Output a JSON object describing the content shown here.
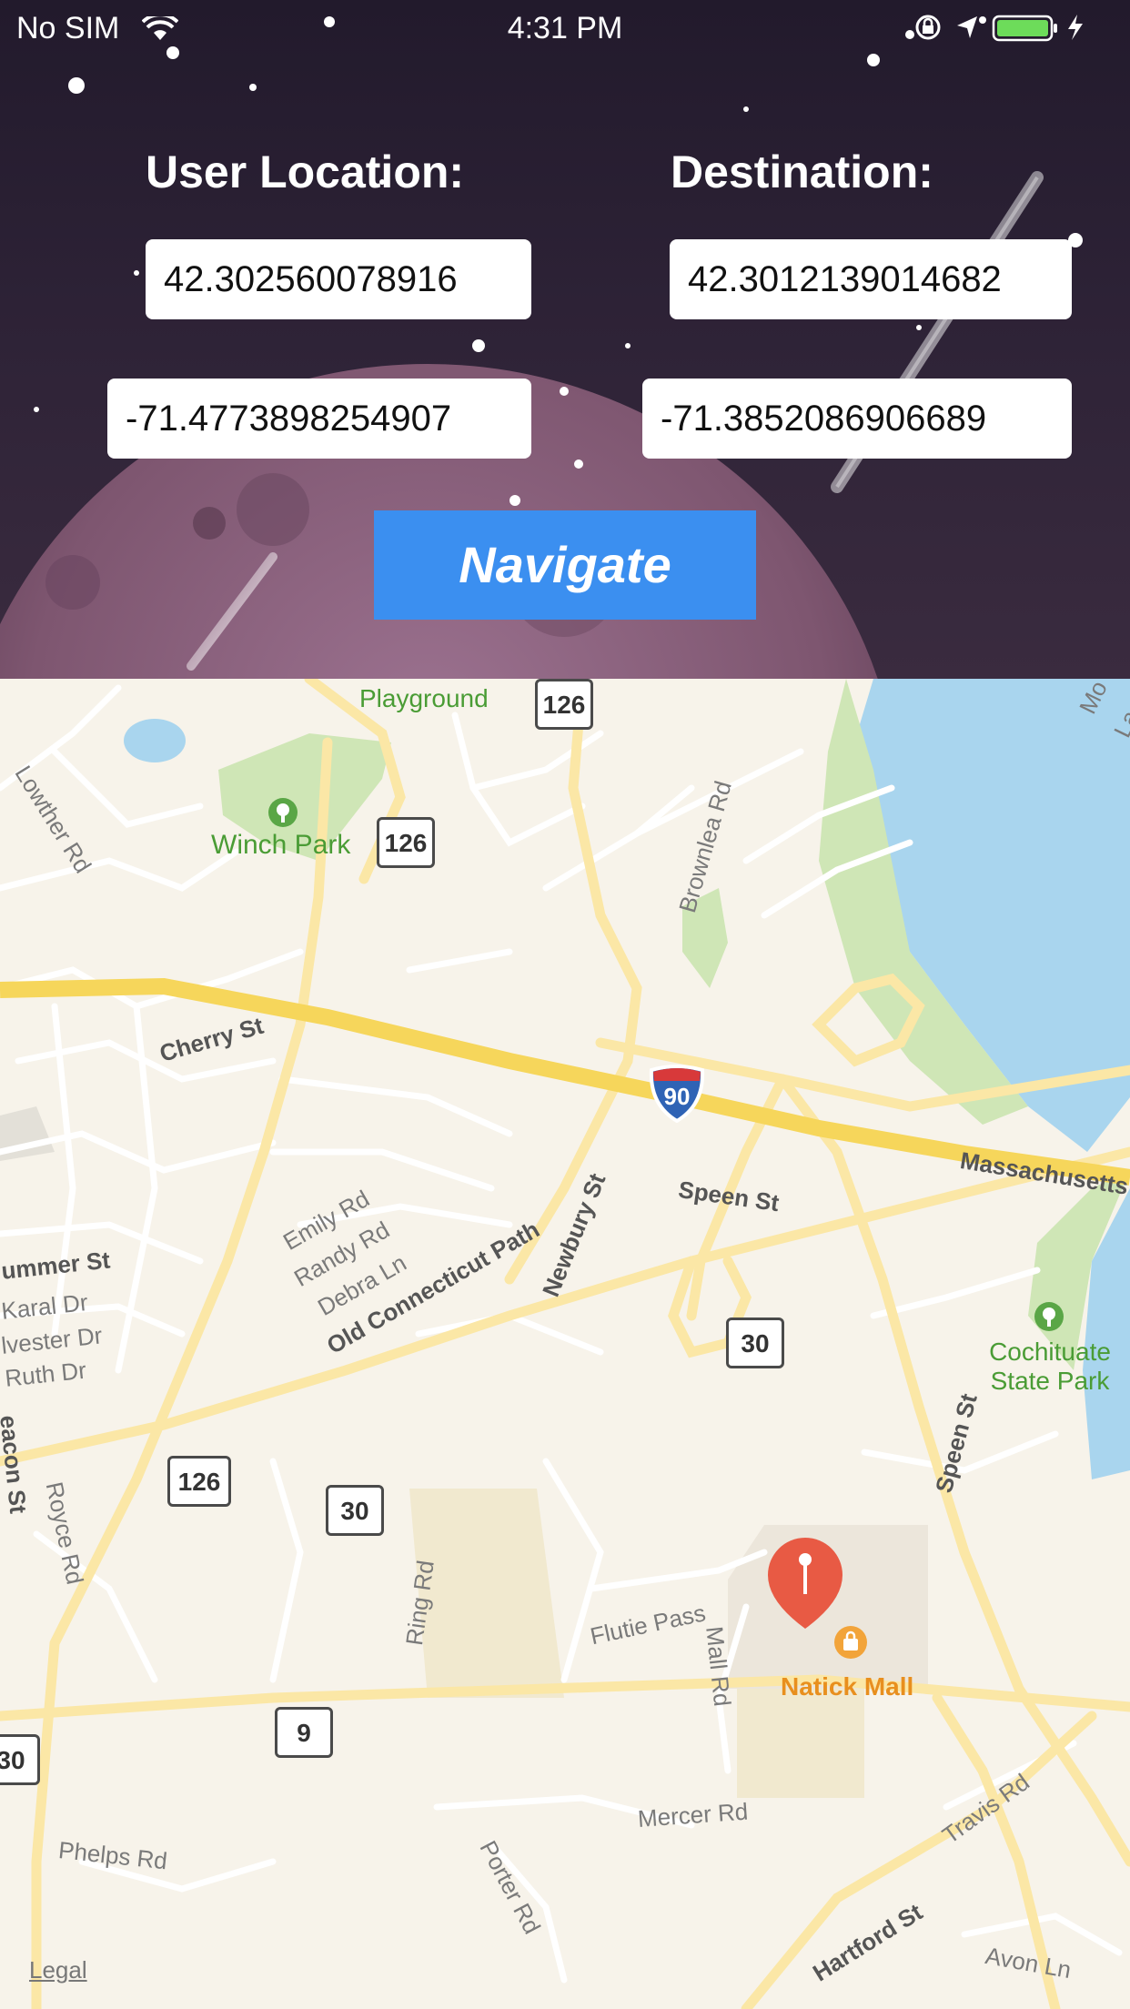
{
  "status_bar": {
    "carrier": "No SIM",
    "time": "4:31 PM"
  },
  "form": {
    "user_location_label": "User Location:",
    "destination_label": "Destination:",
    "user_latitude": "42.302560078916",
    "user_longitude": "-71.4773898254907",
    "dest_latitude": "42.3012139014682",
    "dest_longitude": "-71.3852086906689",
    "navigate_label": "Navigate"
  },
  "colors": {
    "button": "#3b8ff0",
    "pin": "#e85a44",
    "highway": "#f6d65b",
    "water": "#a9d5ee",
    "park": "#c9e3b0"
  },
  "map": {
    "labels": {
      "playground": "Playground",
      "winch_park": "Winch Park",
      "lowther_rd": "Lowther Rd",
      "brownlea_rd": "Brownlea Rd",
      "cherry_st": "Cherry St",
      "massachusetts": "Massachusetts",
      "speen_st": "Speen St",
      "speen_st_2": "Speen St",
      "newbury_st": "Newbury St",
      "old_connecticut_path": "Old Connecticut Path",
      "emily_rd": "Emily Rd",
      "randy_rd": "Randy Rd",
      "debra_ln": "Debra Ln",
      "summer_st": "ummer St",
      "karal_dr": "Karal Dr",
      "sylvester_dr": "lvester Dr",
      "ruth_dr": "Ruth Dr",
      "beacon_st": "eacon St",
      "royce_rd": "Royce Rd",
      "ring_rd": "Ring Rd",
      "flutie_pass": "Flutie Pass",
      "mall_rd": "Mall Rd",
      "natick_mall": "Natick Mall",
      "cochituate_state_park": "Cochituate State Park",
      "mercer_rd": "Mercer Rd",
      "phelps_rd": "Phelps Rd",
      "porter_rd": "Porter Rd",
      "hartford_st": "Hartford St",
      "travis_rd": "Travis Rd",
      "avon_ln": "Avon Ln",
      "mo": "Mo",
      "la": "La"
    },
    "shields": {
      "r126_top": "126",
      "r126_mid": "126",
      "r126_low": "126",
      "i90": "90",
      "r30_a": "30",
      "r30_b": "30",
      "r30_c": "30",
      "r9": "9"
    },
    "legal": "Legal"
  },
  "icons": [
    "wifi-icon",
    "orientation-lock-icon",
    "location-arrow-icon",
    "battery-icon",
    "charging-icon",
    "map-pin-icon",
    "tree-icon",
    "shopping-bag-icon"
  ]
}
